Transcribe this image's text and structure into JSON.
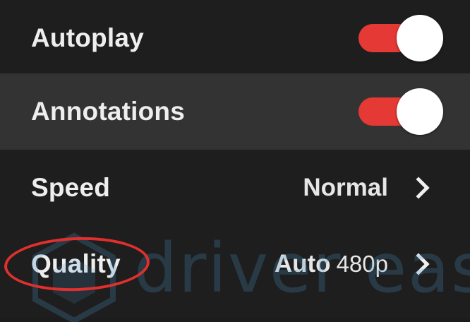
{
  "settings_menu": {
    "items": [
      {
        "label": "Autoplay",
        "type": "toggle",
        "enabled": true
      },
      {
        "label": "Annotations",
        "type": "toggle",
        "enabled": true
      },
      {
        "label": "Speed",
        "type": "submenu",
        "value": "Normal"
      },
      {
        "label": "Quality",
        "type": "submenu",
        "value": "Auto",
        "value_sub": "480p"
      }
    ],
    "highlighted_item": "Quality"
  },
  "watermark": {
    "text": "driver easy"
  },
  "colors": {
    "background": "#1e1e1e",
    "hover_row": "#333333",
    "toggle_on": "#e53935",
    "highlight_ring": "#e0302e",
    "text": "#eeeeee"
  },
  "icons": {
    "chevron": "chevron-right-icon",
    "watermark_logo": "driver-easy-logo-icon"
  }
}
